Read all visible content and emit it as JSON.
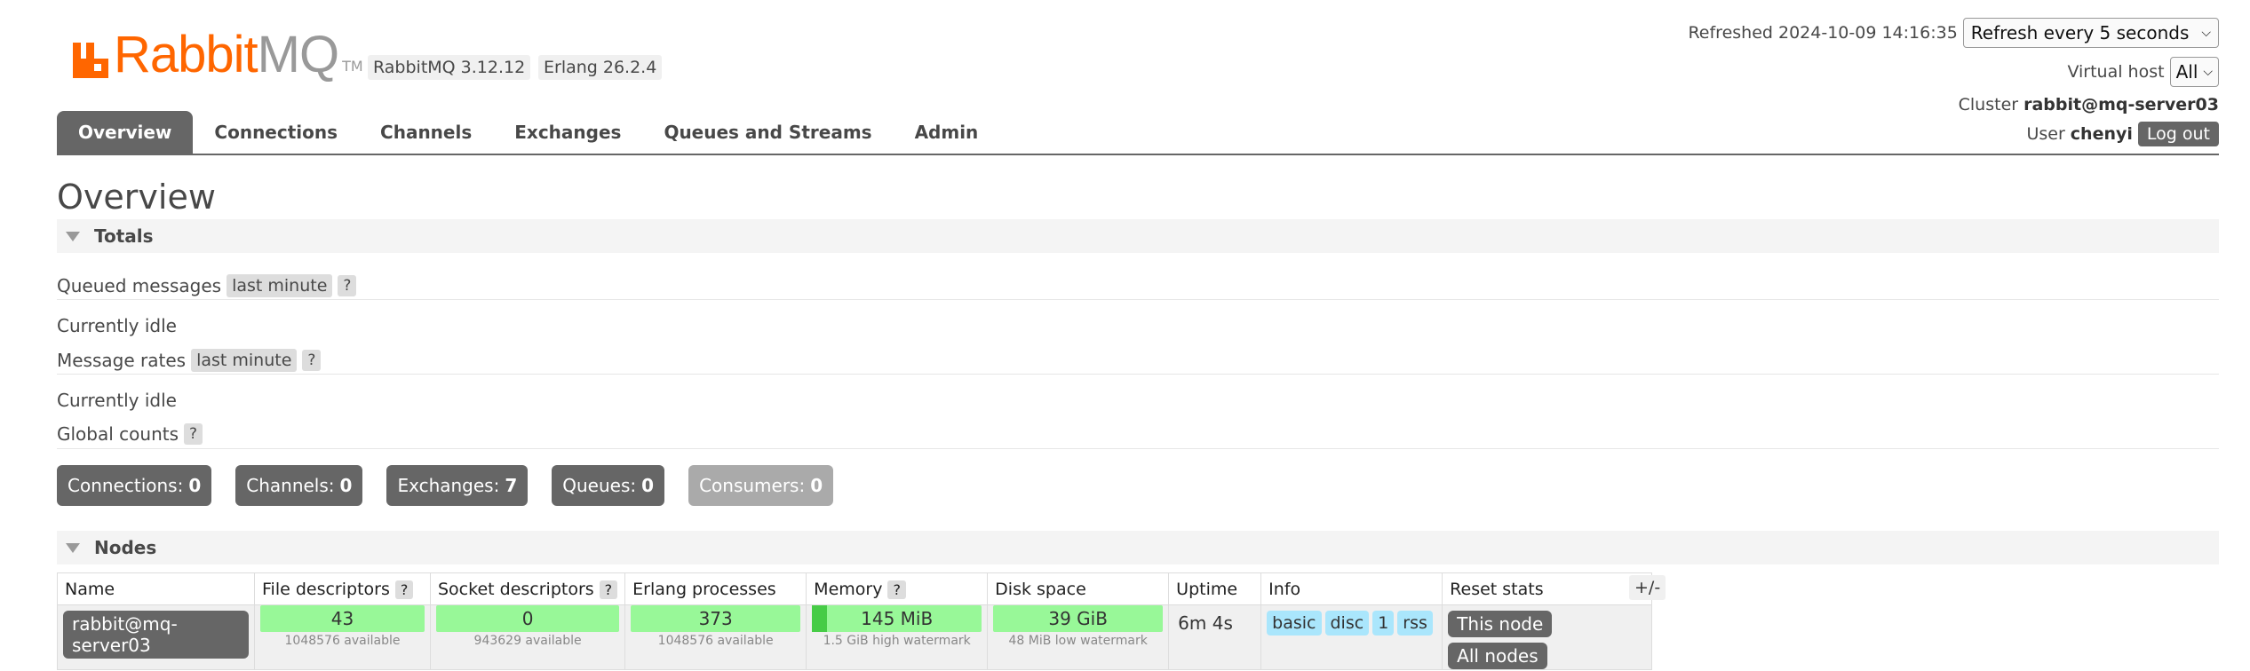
{
  "logo": {
    "rabbit": "Rabbit",
    "mq": "MQ",
    "tm": "TM"
  },
  "versions": {
    "rabbitmq": "RabbitMQ 3.12.12",
    "erlang": "Erlang 26.2.4"
  },
  "topright": {
    "refreshed": "Refreshed 2024-10-09 14:16:35",
    "refresh_option": "Refresh every 5 seconds",
    "vhost_label": "Virtual host",
    "vhost_value": "All",
    "cluster_label": "Cluster",
    "cluster_value": "rabbit@mq-server03",
    "user_label": "User",
    "user_value": "chenyi",
    "logout": "Log out"
  },
  "tabs": [
    "Overview",
    "Connections",
    "Channels",
    "Exchanges",
    "Queues and Streams",
    "Admin"
  ],
  "page_title": "Overview",
  "totals": {
    "section": "Totals",
    "queued_label": "Queued messages",
    "queued_range": "last minute",
    "help": "?",
    "queued_status": "Currently idle",
    "rates_label": "Message rates",
    "rates_range": "last minute",
    "rates_status": "Currently idle",
    "global_label": "Global counts"
  },
  "counts": [
    {
      "label": "Connections:",
      "value": "0"
    },
    {
      "label": "Channels:",
      "value": "0"
    },
    {
      "label": "Exchanges:",
      "value": "7"
    },
    {
      "label": "Queues:",
      "value": "0"
    },
    {
      "label": "Consumers:",
      "value": "0"
    }
  ],
  "nodes": {
    "section": "Nodes",
    "headers": [
      "Name",
      "File descriptors",
      "Socket descriptors",
      "Erlang processes",
      "Memory",
      "Disk space",
      "Uptime",
      "Info",
      "Reset stats"
    ],
    "plusminus": "+/-",
    "row": {
      "name": "rabbit@mq-server03",
      "fd": "43",
      "fd_sub": "1048576 available",
      "sd": "0",
      "sd_sub": "943629 available",
      "ep": "373",
      "ep_sub": "1048576 available",
      "mem": "145 MiB",
      "mem_sub": "1.5 GiB high watermark",
      "mem_fraction": 0.09,
      "disk": "39 GiB",
      "disk_sub": "48 MiB low watermark",
      "uptime": "6m 4s",
      "info": [
        "basic",
        "disc",
        "1",
        "rss"
      ],
      "reset_this": "This node",
      "reset_all": "All nodes"
    }
  },
  "colors": {
    "brand_orange": "#ff6600",
    "bar_green": "#98f898",
    "info_blue": "#aae6fc",
    "dark_grey": "#666666"
  }
}
